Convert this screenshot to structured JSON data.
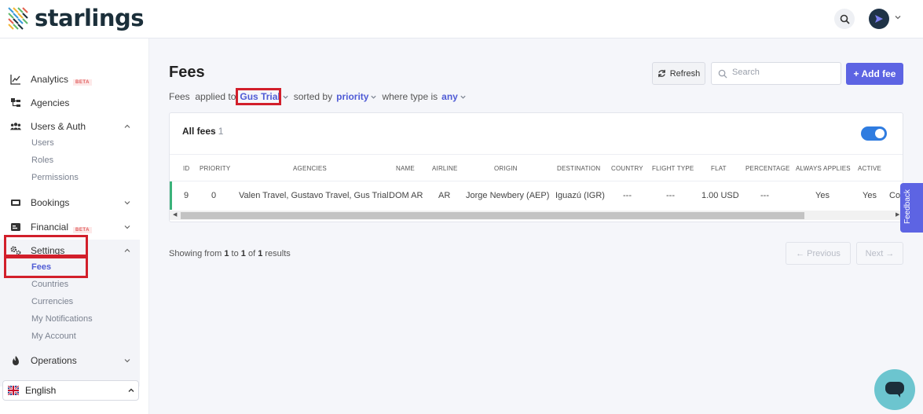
{
  "app": {
    "brand": "starlings"
  },
  "topbar": {
    "search_icon": "search-icon",
    "avatar_icon": "send-arrow-icon"
  },
  "sidebar": {
    "analytics": {
      "label": "Analytics",
      "badge": "BETA"
    },
    "agencies": {
      "label": "Agencies"
    },
    "users_auth": {
      "label": "Users & Auth",
      "children": [
        "Users",
        "Roles",
        "Permissions"
      ]
    },
    "bookings": {
      "label": "Bookings"
    },
    "financial": {
      "label": "Financial",
      "badge": "BETA"
    },
    "settings": {
      "label": "Settings",
      "children": [
        "Fees",
        "Countries",
        "Currencies",
        "My Notifications",
        "My Account"
      ],
      "active_child": "Fees"
    },
    "operations": {
      "label": "Operations"
    },
    "language": {
      "label": "English"
    }
  },
  "page": {
    "title": "Fees",
    "filter": {
      "prefix": "Fees  applied to",
      "applied_to": "Gus Trial",
      "sorted_by_label": "sorted by",
      "sorted_by": "priority",
      "where_label": "where type is",
      "type": "any"
    },
    "refresh_label": "Refresh",
    "search_placeholder": "Search",
    "add_label": "+ Add fee"
  },
  "table": {
    "title": "All fees",
    "count": "1",
    "columns": [
      "ID",
      "PRIORITY",
      "AGENCIES",
      "NAME",
      "AIRLINE",
      "ORIGIN",
      "DESTINATION",
      "COUNTRY",
      "FLIGHT TYPE",
      "FLAT",
      "PERCENTAGE",
      "ALWAYS APPLIES",
      "ACTIVE"
    ],
    "rows": [
      {
        "id": "9",
        "priority": "0",
        "agencies": "Valen Travel, Gustavo Travel, Gus Trial",
        "name": "DOM AR",
        "airline": "AR",
        "origin": "Jorge Newbery (AEP)",
        "destination": "Iguazú (IGR)",
        "country": "---",
        "flight_type": "---",
        "flat": "1.00 USD",
        "percentage": "---",
        "always_applies": "Yes",
        "active": "Yes",
        "overflow": "Co"
      }
    ]
  },
  "pagination": {
    "showing_prefix": "Showing from",
    "from": "1",
    "to_label": "to",
    "to": "1",
    "of_label": "of",
    "total": "1",
    "results_label": "results",
    "previous_label": "← Previous",
    "next_label": "Next →"
  },
  "feedback": {
    "label": "Feedback"
  },
  "colors": {
    "accent": "#5d64e3",
    "highlight": "#d21f2b",
    "toggle": "#2f7ce0",
    "row_accent": "#3ab27a"
  }
}
